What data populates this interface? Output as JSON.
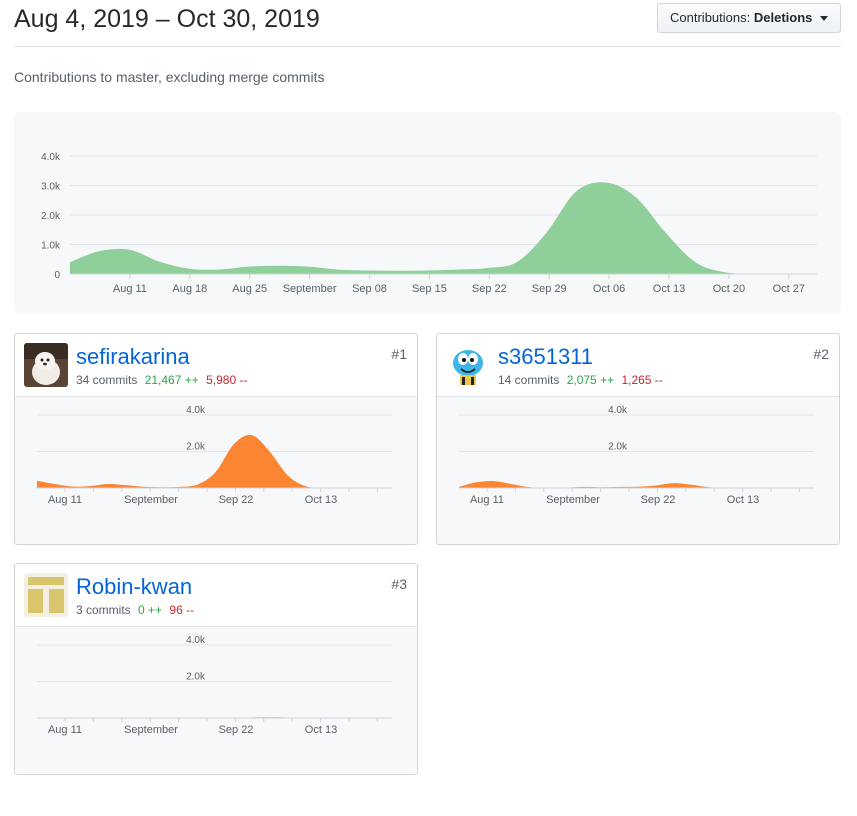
{
  "header": {
    "date_range": "Aug 4, 2019 – Oct 30, 2019",
    "contributions_label": "Contributions:",
    "contributions_value": "Deletions"
  },
  "subtitle": "Contributions to master, excluding merge commits",
  "colors": {
    "main_area": "#8fcf9a",
    "user_area": "#fb8532",
    "link": "#0366d6",
    "additions": "#28a745",
    "deletions": "#cb2431"
  },
  "chart_data": [
    {
      "type": "area",
      "series": [
        {
          "values": [
            400,
            780,
            820,
            420,
            180,
            150,
            250,
            280,
            250,
            150,
            120,
            110,
            120,
            150,
            200,
            400,
            1400,
            2800,
            3100,
            2600,
            1400,
            400,
            60,
            10,
            5,
            0
          ]
        }
      ],
      "x_dates": [
        "Aug 4",
        "Aug 11",
        "Aug 18",
        "Aug 25",
        "Sep 1",
        "Sep 8",
        "Sep 15",
        "Sep 22",
        "Sep 29",
        "Oct 6",
        "Oct 13",
        "Oct 20",
        "Oct 27"
      ],
      "x_start_day": "Aug 4",
      "x_end_day": "Oct 30",
      "x_ticks": [
        "Aug 11",
        "Aug 18",
        "Aug 25",
        "September",
        "Sep 08",
        "Sep 15",
        "Sep 22",
        "Sep 29",
        "Oct 06",
        "Oct 13",
        "Oct 20",
        "Oct 27"
      ],
      "y_ticks": [
        "0",
        "1.0k",
        "2.0k",
        "3.0k",
        "4.0k"
      ],
      "ylim": [
        0,
        4000
      ],
      "grid": true
    },
    {
      "type": "area",
      "series": [
        {
          "name": "sefirakarina",
          "values": [
            400,
            220,
            80,
            110,
            220,
            150,
            60,
            40,
            60,
            200,
            900,
            2400,
            2900,
            2000,
            700,
            100,
            10,
            0,
            0,
            0
          ]
        }
      ],
      "x_ticks": [
        "Aug 11",
        "September",
        "Sep 22",
        "Oct 13"
      ],
      "y_ticks": [
        "2.0k",
        "4.0k"
      ],
      "ylim": [
        0,
        4000
      ],
      "grid": true
    },
    {
      "type": "area",
      "series": [
        {
          "name": "s3651311",
          "values": [
            60,
            320,
            380,
            200,
            40,
            10,
            20,
            60,
            40,
            60,
            70,
            140,
            270,
            180,
            40,
            5,
            0,
            0,
            0,
            0
          ]
        }
      ],
      "x_ticks": [
        "Aug 11",
        "September",
        "Sep 22",
        "Oct 13"
      ],
      "y_ticks": [
        "2.0k",
        "4.0k"
      ],
      "ylim": [
        0,
        4000
      ],
      "grid": true
    },
    {
      "type": "area",
      "series": [
        {
          "name": "Robin-kwan",
          "values": [
            0,
            0,
            0,
            0,
            0,
            0,
            0,
            0,
            0,
            0,
            0,
            0,
            30,
            40,
            30,
            0,
            0,
            0,
            0,
            0
          ]
        }
      ],
      "x_ticks": [
        "Aug 11",
        "September",
        "Sep 22",
        "Oct 13"
      ],
      "y_ticks": [
        "2.0k",
        "4.0k"
      ],
      "ylim": [
        0,
        4000
      ],
      "grid": true
    }
  ],
  "contributors": [
    {
      "rank": "#1",
      "username": "sefirakarina",
      "commits": "34 commits",
      "additions": "21,467 ++",
      "deletions": "5,980 --"
    },
    {
      "rank": "#2",
      "username": "s3651311",
      "commits": "14 commits",
      "additions": "2,075 ++",
      "deletions": "1,265 --"
    },
    {
      "rank": "#3",
      "username": "Robin-kwan",
      "commits": "3 commits",
      "additions": "0 ++",
      "deletions": "96 --"
    }
  ]
}
